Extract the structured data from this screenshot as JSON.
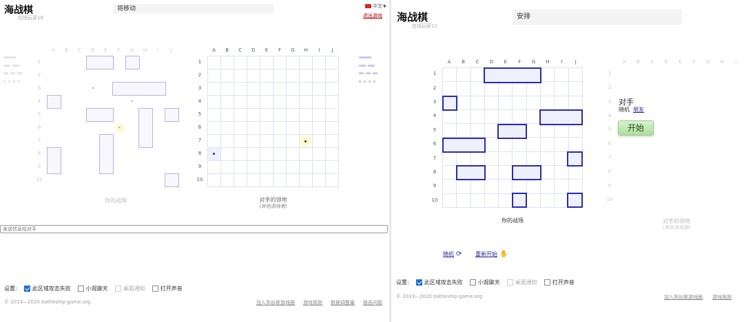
{
  "left": {
    "title": "海战棋",
    "subtitle": "在线玩家18",
    "status": "将移动",
    "language": "中文",
    "exit_link": "退出游戏",
    "my_caption": "你的战场",
    "enemy_caption": "对手的领地",
    "enemy_subcaption": "(其他游戏者)",
    "chat_placeholder": "发送信息给对手"
  },
  "right": {
    "title": "海战棋",
    "subtitle": "在线玩家11",
    "status": "安排",
    "my_caption": "你的战场",
    "opponent_label": "对手",
    "random_label": "随机",
    "friend_link": "朋友",
    "start_button": "开始",
    "random_button": "随机",
    "reset_button": "重新开始",
    "enemy_caption": "对手的领地",
    "enemy_subcaption": "(其他游戏者)"
  },
  "columns": [
    "A",
    "B",
    "C",
    "D",
    "E",
    "F",
    "G",
    "H",
    "I",
    "J"
  ],
  "rows": [
    "1",
    "2",
    "3",
    "4",
    "5",
    "6",
    "7",
    "8",
    "9",
    "10"
  ],
  "settings": {
    "label": "设置:",
    "items": [
      {
        "label": "此区域攻击失败",
        "checked": true,
        "disabled": false
      },
      {
        "label": "小观聊天",
        "checked": false,
        "disabled": false
      },
      {
        "label": "桌面通知",
        "checked": false,
        "disabled": true
      },
      {
        "label": "打开声音",
        "checked": false,
        "disabled": false
      }
    ]
  },
  "footer": {
    "copyright": "© 2013—2020 battleship-game.org",
    "links": [
      "加入到谷歌游戏圈",
      "游戏规则",
      "数据调整量",
      "报告问题"
    ],
    "links_right": [
      "加入到谷歌游戏圈",
      "游戏规则"
    ]
  },
  "colors": {
    "ship_border": "#2a2ab0",
    "ship_fill": "#eef0fb",
    "start_button": "#aedd9e",
    "checkbox_checked": "#1d6fd1"
  }
}
